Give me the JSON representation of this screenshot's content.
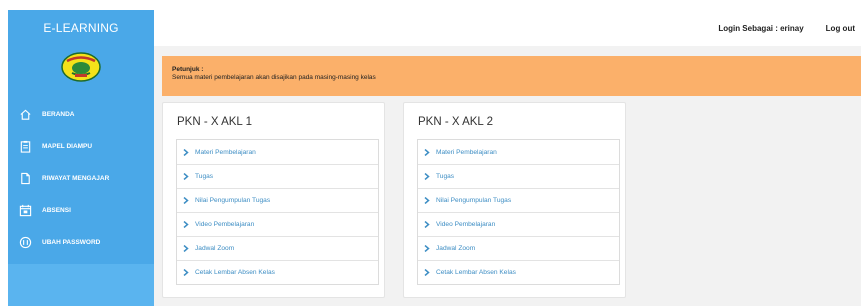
{
  "sidebar": {
    "brand": "E-LEARNING",
    "logo_icon": "school-emblem-logo",
    "items": [
      {
        "label": "BERANDA",
        "icon": "home-icon"
      },
      {
        "label": "MAPEL DIAMPU",
        "icon": "clipboard-icon"
      },
      {
        "label": "RIWAYAT MENGAJAR",
        "icon": "document-icon"
      },
      {
        "label": "ABSENSI",
        "icon": "calendar-icon"
      },
      {
        "label": "UBAH PASSWORD",
        "icon": "lock-icon"
      }
    ]
  },
  "topbar": {
    "login_text": "Login Sebagai : erinay",
    "logout_label": "Log out"
  },
  "notice": {
    "title": "Petunjuk :",
    "message": "Semua materi pembelajaran akan disajikan pada masing-masing kelas"
  },
  "classes": [
    {
      "name": "PKN - X AKL 1",
      "links": [
        "Materi Pembelajaran",
        "Tugas",
        "Nilai Pengumpulan Tugas",
        "Video Pembelajaran",
        "Jadwal Zoom",
        "Cetak Lembar Absen Kelas"
      ]
    },
    {
      "name": "PKN - X AKL 2",
      "links": [
        "Materi Pembelajaran",
        "Tugas",
        "Nilai Pengumpulan Tugas",
        "Video Pembelajaran",
        "Jadwal Zoom",
        "Cetak Lembar Absen Kelas"
      ]
    }
  ],
  "colors": {
    "sidebar": "#4aa8e8",
    "notice": "#fbb06a",
    "link": "#3e8ec4"
  }
}
